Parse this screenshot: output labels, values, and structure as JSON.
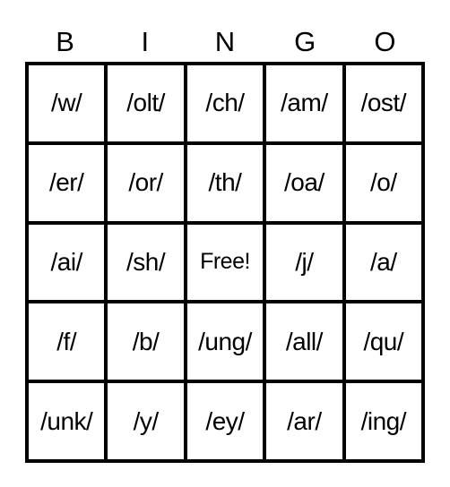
{
  "header": {
    "letters": [
      "B",
      "I",
      "N",
      "G",
      "O"
    ]
  },
  "board": {
    "rows": [
      [
        "/w/",
        "/olt/",
        "/ch/",
        "/am/",
        "/ost/"
      ],
      [
        "/er/",
        "/or/",
        "/th/",
        "/oa/",
        "/o/"
      ],
      [
        "/ai/",
        "/sh/",
        "Free!",
        "/j/",
        "/a/"
      ],
      [
        "/f/",
        "/b/",
        "/ung/",
        "/all/",
        "/qu/"
      ],
      [
        "/unk/",
        "/y/",
        "/ey/",
        "/ar/",
        "/ing/"
      ]
    ],
    "free_space": {
      "row": 2,
      "col": 2
    }
  }
}
